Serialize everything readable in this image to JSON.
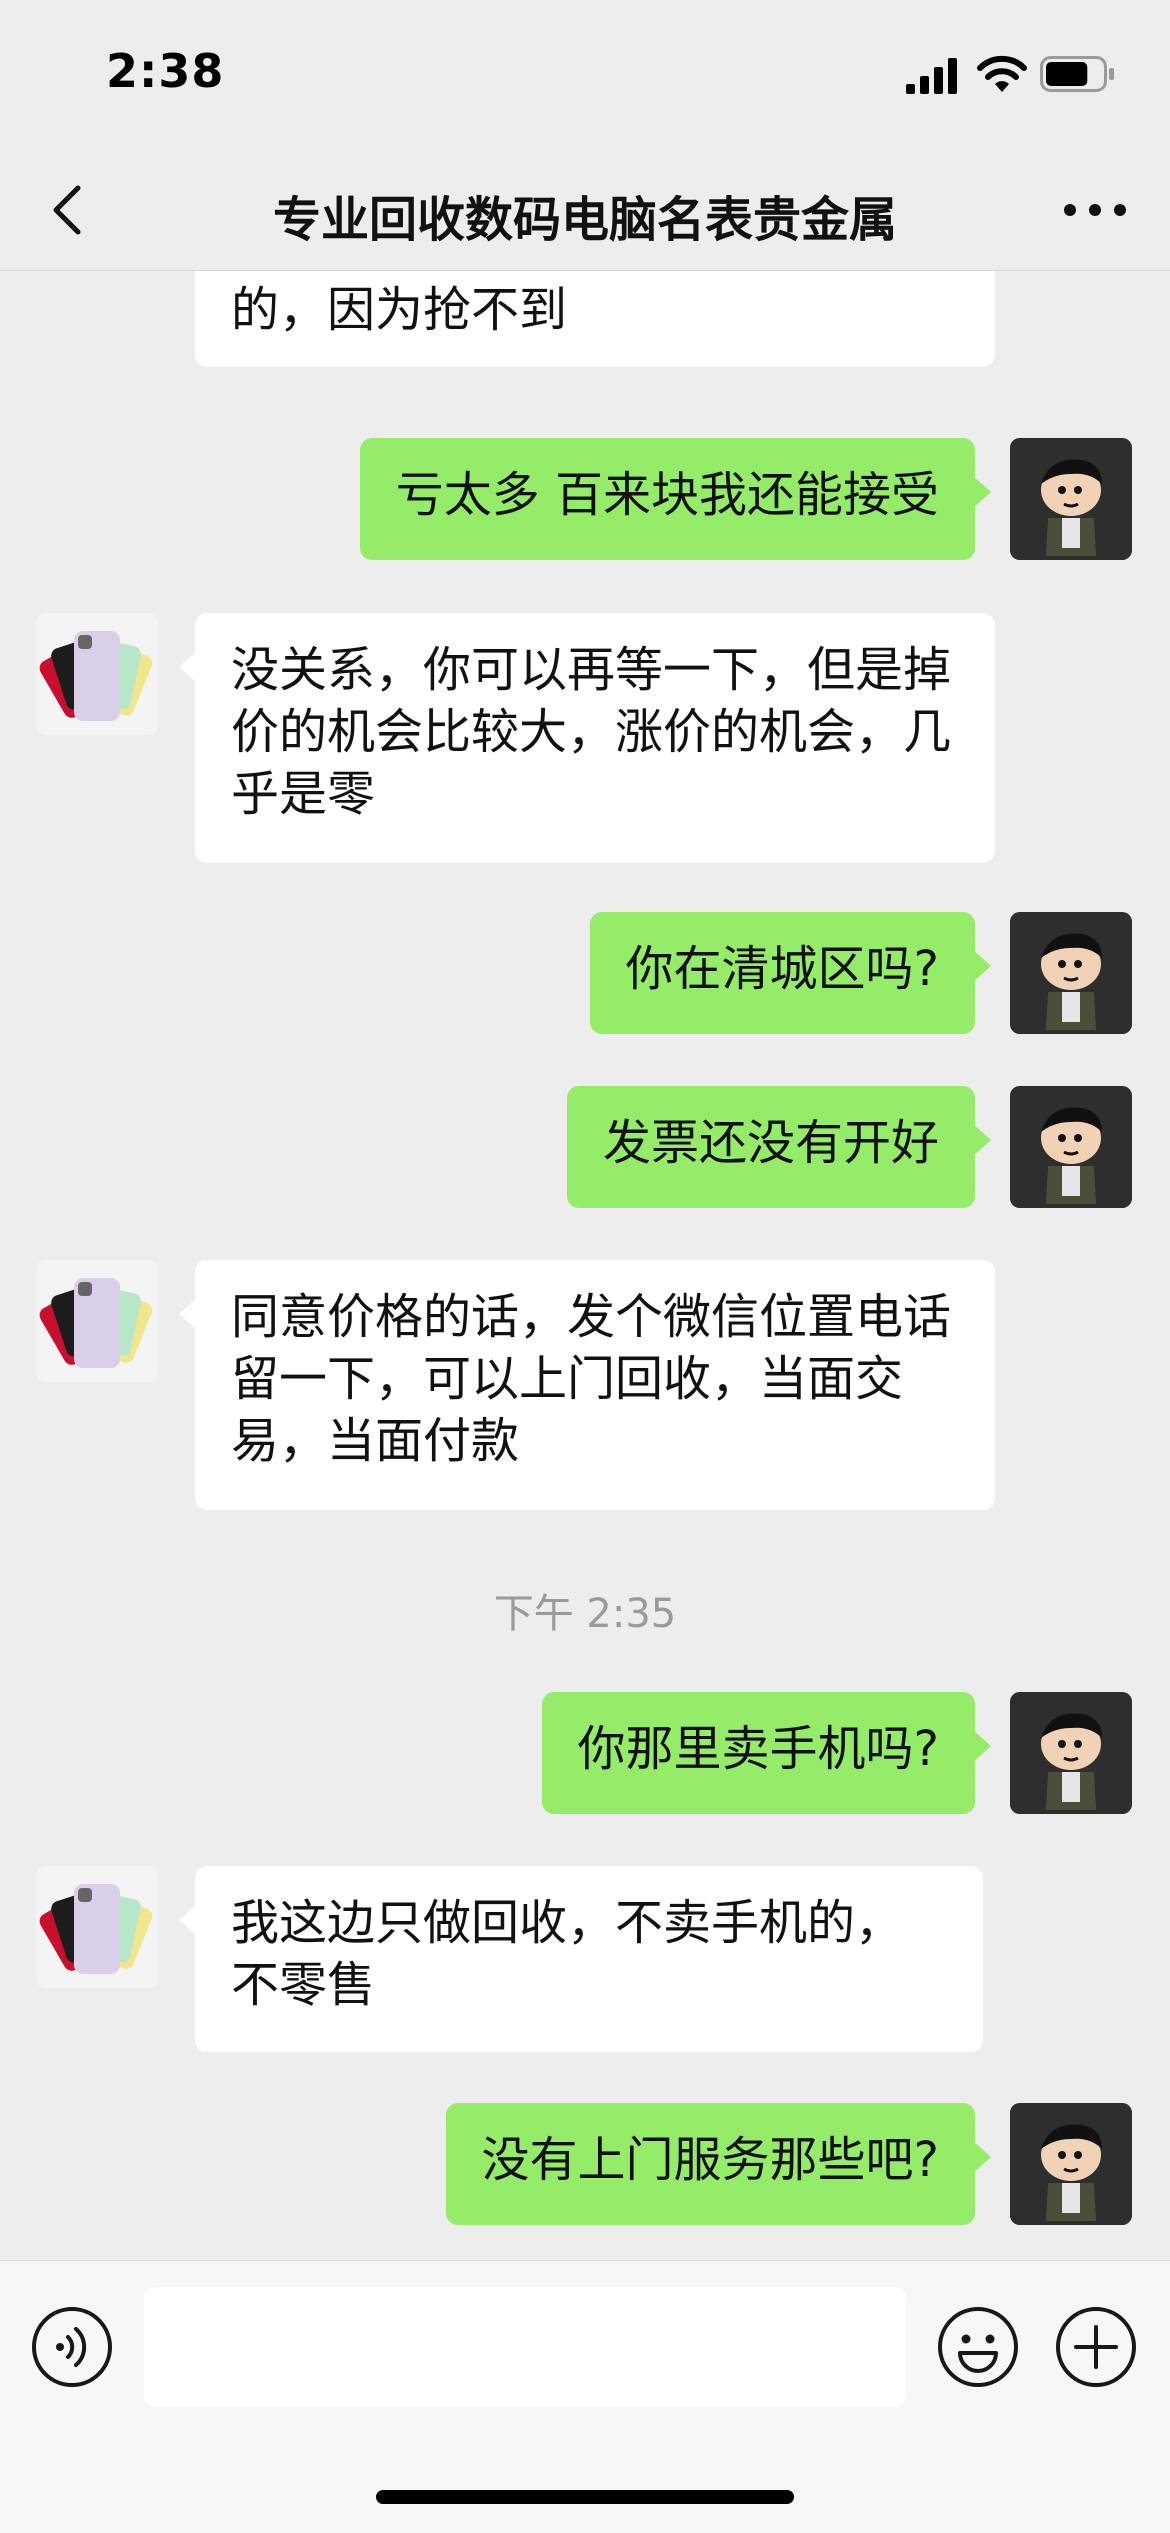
{
  "status_bar": {
    "time": "2:38",
    "battery_level": 0.75
  },
  "header": {
    "title": "专业回收数码电脑名表贵金属"
  },
  "messages": [
    {
      "side": "peer",
      "text": "的，因为抢不到"
    },
    {
      "side": "me",
      "text": "亏太多 百来块我还能接受"
    },
    {
      "side": "peer",
      "text": "没关系，你可以再等一下，但是掉价的机会比较大，涨价的机会，几乎是零"
    },
    {
      "side": "me",
      "text": "你在清城区吗?"
    },
    {
      "side": "me",
      "text": "发票还没有开好"
    },
    {
      "side": "peer",
      "text": "同意价格的话，发个微信位置电话留一下，可以上门回收，当面交易，当面付款"
    },
    {
      "timestamp": "下午 2:35"
    },
    {
      "side": "me",
      "text": "你那里卖手机吗?"
    },
    {
      "side": "peer",
      "text": "我这边只做回收，不卖手机的，不零售"
    },
    {
      "side": "me",
      "text": "没有上门服务那些吧?"
    }
  ],
  "input": {
    "value": "",
    "placeholder": ""
  },
  "colors": {
    "sent_bubble": "#95ec69",
    "received_bubble": "#ffffff",
    "background": "#ededed"
  },
  "icons": {
    "back": "chevron-left-icon",
    "more": "more-dots-icon",
    "voice": "voice-icon",
    "emoji": "emoji-icon",
    "add": "plus-icon"
  }
}
